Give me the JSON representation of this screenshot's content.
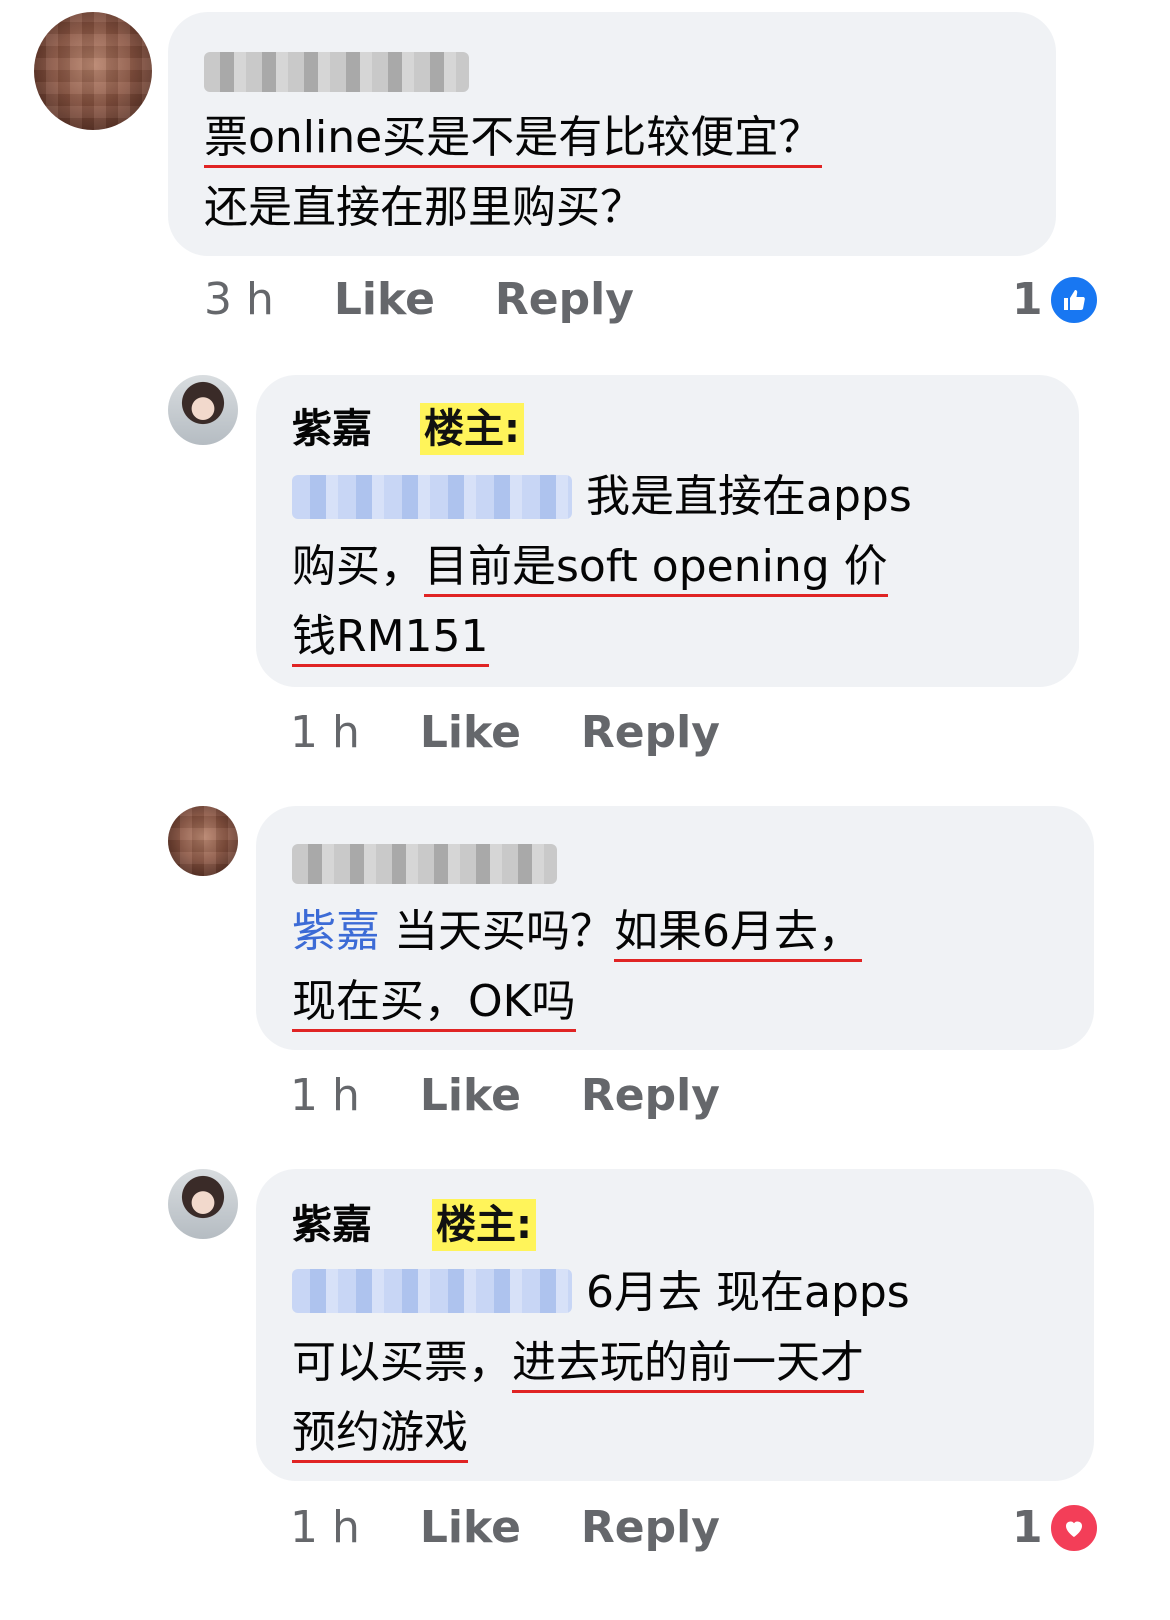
{
  "comments": [
    {
      "author": "",
      "lines": [
        "票online买是不是有比较便宜？",
        "还是直接在那里购买？"
      ],
      "time": "3 h",
      "like": "Like",
      "reply": "Reply",
      "reaction_count": "1",
      "reaction": "like-icon"
    },
    {
      "author": "紫嘉",
      "badge": "楼主:",
      "lines": [
        "我是直接在apps",
        "购买，",
        "目前是soft opening 价",
        "钱RM151"
      ],
      "time": "1 h",
      "like": "Like",
      "reply": "Reply"
    },
    {
      "author": "",
      "mention": "紫嘉",
      "lines": [
        "当天买吗？",
        "如果6月去，",
        "现在买，OK吗"
      ],
      "time": "1 h",
      "like": "Like",
      "reply": "Reply"
    },
    {
      "author": "紫嘉",
      "badge": "楼主:",
      "lines": [
        "6月去 现在apps",
        "可以买票，",
        "进去玩的前一天才",
        "预约游戏"
      ],
      "time": "1 h",
      "like": "Like",
      "reply": "Reply",
      "reaction_count": "1",
      "reaction": "love-icon"
    }
  ],
  "colors": {
    "bubble": "#f0f2f5",
    "underline": "#e02424",
    "badge": "#fff45a",
    "mention": "#3c6bd6",
    "like": "#1877f2",
    "love": "#f33e58",
    "meta": "#65676b"
  }
}
